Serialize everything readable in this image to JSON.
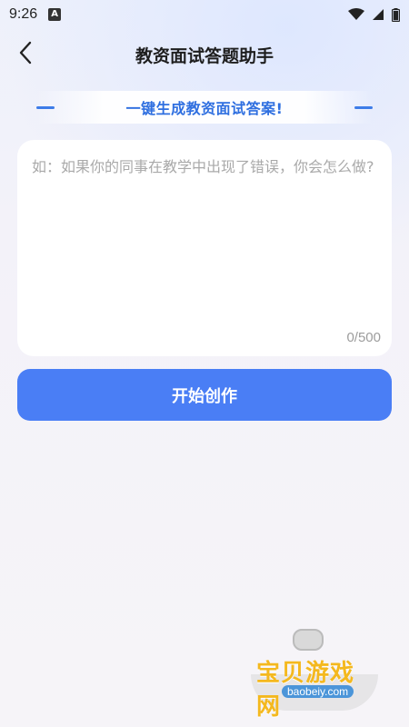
{
  "status_bar": {
    "time": "9:26",
    "app_indicator": "A",
    "icons": [
      "wifi-icon",
      "signal-icon",
      "battery-icon"
    ]
  },
  "nav": {
    "back_icon": "chevron-left-icon",
    "title": "教资面试答题助手"
  },
  "banner": {
    "text": "一键生成教资面试答案!"
  },
  "input": {
    "value": "",
    "placeholder": "如：如果你的同事在教学中出现了错误，你会怎么做?",
    "char_count": "0/500"
  },
  "actions": {
    "create_label": "开始创作"
  },
  "watermark": {
    "main": "宝贝游戏网",
    "url": "baobeiy.com"
  },
  "colors": {
    "accent": "#4a7ef5",
    "banner_text": "#2f6fe0",
    "watermark_text": "#f4b81e"
  }
}
